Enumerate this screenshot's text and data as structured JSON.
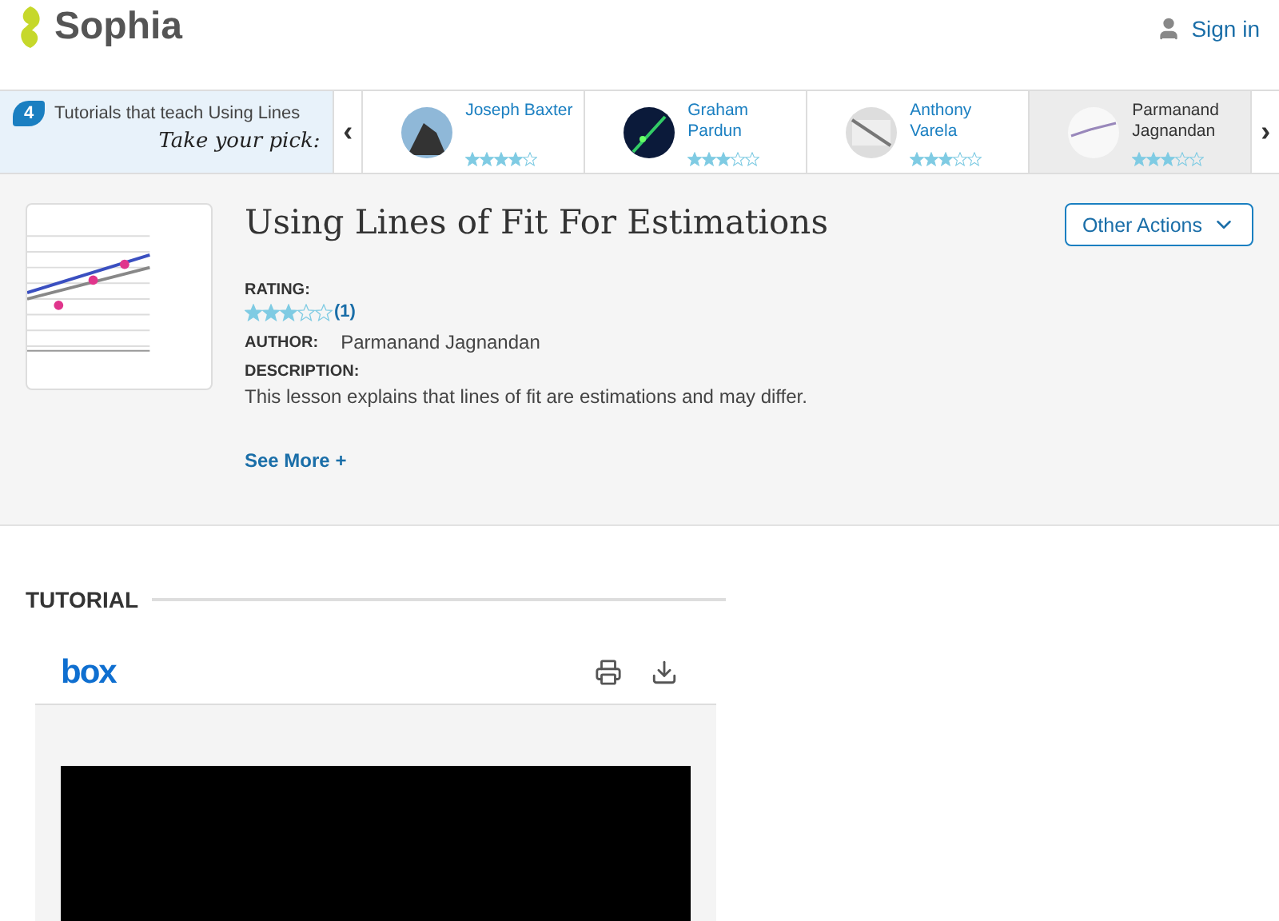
{
  "header": {
    "logo": "Sophia",
    "sign_in": "Sign in"
  },
  "carousel": {
    "count": "4",
    "intro": "Tutorials that teach Using Lines",
    "tagline": "Take your pick:",
    "prev": "‹",
    "next": "›",
    "cards": [
      {
        "name": "Joseph Baxter",
        "stars": 4,
        "selected": false
      },
      {
        "name": "Graham Pardun",
        "stars": 3,
        "selected": false
      },
      {
        "name": "Anthony Varela",
        "stars": 3,
        "selected": false
      },
      {
        "name": "Parmanand Jagnandan",
        "stars": 3,
        "selected": true
      }
    ]
  },
  "lesson": {
    "title": "Using Lines of Fit For Estimations",
    "actions": "Other Actions",
    "rating_label": "RATING:",
    "stars": 3,
    "rating_count": "(1)",
    "author_label": "AUTHOR:",
    "author": "Parmanand Jagnandan",
    "description_label": "DESCRIPTION:",
    "description": "This lesson explains that lines of fit are estimations and may differ.",
    "see_more": "See More +"
  },
  "tutorial": {
    "heading": "TUTORIAL",
    "viewer_logo": "box"
  }
}
